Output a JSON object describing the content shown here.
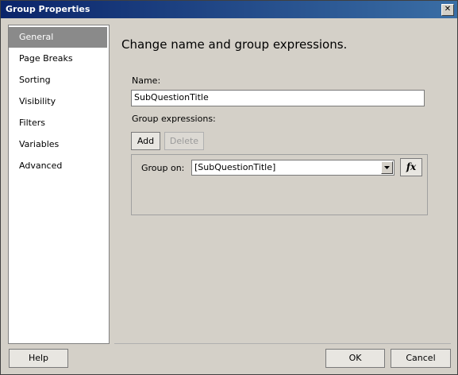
{
  "window": {
    "title": "Group Properties",
    "close_glyph": "✕"
  },
  "nav": {
    "items": [
      {
        "label": "General",
        "selected": true
      },
      {
        "label": "Page Breaks"
      },
      {
        "label": "Sorting"
      },
      {
        "label": "Visibility"
      },
      {
        "label": "Filters"
      },
      {
        "label": "Variables"
      },
      {
        "label": "Advanced"
      }
    ]
  },
  "main": {
    "heading": "Change name and group expressions.",
    "name_label": "Name:",
    "name_value": "SubQuestionTitle",
    "group_expr_label": "Group expressions:",
    "add_label": "Add",
    "delete_label": "Delete",
    "group_on_label": "Group on:",
    "group_on_value": "[SubQuestionTitle]",
    "fx_label": "fx"
  },
  "footer": {
    "help_label": "Help",
    "ok_label": "OK",
    "cancel_label": "Cancel"
  },
  "colors": {
    "title_bar": "#0a246a",
    "selected_nav": "#8a8a8a",
    "dialog_bg": "#d4d0c8"
  },
  "icons": {
    "close": "close-icon",
    "dropdown": "chevron-down-icon",
    "expression": "fx-icon"
  }
}
